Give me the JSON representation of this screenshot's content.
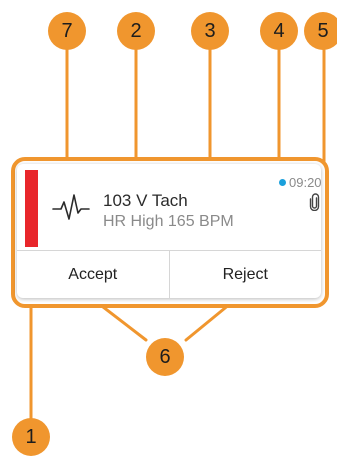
{
  "alarm": {
    "title": "103 V Tach",
    "detail": "HR High 165 BPM",
    "time": "09:20",
    "severity_color": "#E8262B",
    "status_dot_color": "#1aa0dc",
    "icons": {
      "waveform": "ecg-waveform-icon",
      "attachment": "paperclip-icon"
    }
  },
  "actions": {
    "accept_label": "Accept",
    "reject_label": "Reject"
  },
  "callouts": {
    "c1": "1",
    "c2": "2",
    "c3": "3",
    "c4": "4",
    "c5": "5",
    "c6": "6",
    "c7": "7",
    "color": "#F0962E"
  }
}
